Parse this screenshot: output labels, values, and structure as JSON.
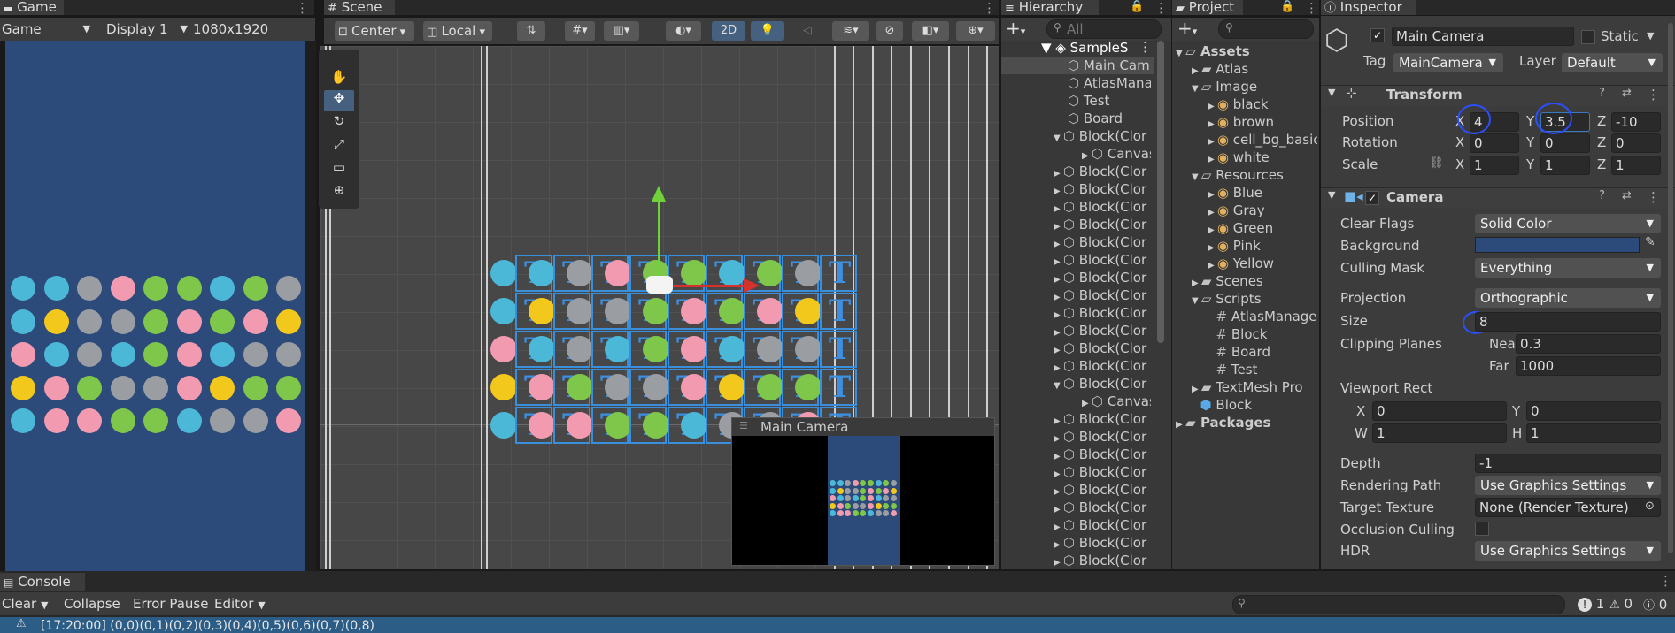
{
  "game": {
    "tab": "Game",
    "mode": "Game",
    "display": "Display 1",
    "resolution": "1080x1920",
    "bg": "#2c4a7a"
  },
  "scene": {
    "tab": "Scene",
    "pivot": "Center",
    "space": "Local",
    "toggle_2d": "2D",
    "preview_title": "Main Camera"
  },
  "hierarchy": {
    "tab": "Hierarchy",
    "search_placeholder": "All",
    "root": "SampleS",
    "items": [
      "Main Cam",
      "AtlasMana",
      "Test",
      "Board",
      "Block(Clor",
      "Canvas",
      "Block(Clor",
      "Block(Clor",
      "Block(Clor",
      "Block(Clor",
      "Block(Clor",
      "Block(Clor",
      "Block(Clor",
      "Block(Clor",
      "Block(Clor",
      "Block(Clor",
      "Block(Clor",
      "Block(Clor",
      "Block(Clor",
      "Canvas",
      "Block(Clor",
      "Block(Clor",
      "Block(Clor",
      "Block(Clor",
      "Block(Clor",
      "Block(Clor",
      "Block(Clor",
      "Block(Clor",
      "Block(Clor"
    ]
  },
  "project": {
    "tab": "Project",
    "tree": [
      {
        "label": "Assets",
        "indent": 0,
        "kind": "folder-open"
      },
      {
        "label": "Atlas",
        "indent": 1,
        "kind": "folder"
      },
      {
        "label": "Image",
        "indent": 1,
        "kind": "folder-open"
      },
      {
        "label": "black",
        "indent": 2,
        "kind": "sprite"
      },
      {
        "label": "brown",
        "indent": 2,
        "kind": "sprite"
      },
      {
        "label": "cell_bg_basic",
        "indent": 2,
        "kind": "sprite"
      },
      {
        "label": "white",
        "indent": 2,
        "kind": "sprite"
      },
      {
        "label": "Resources",
        "indent": 1,
        "kind": "folder-open"
      },
      {
        "label": "Blue",
        "indent": 2,
        "kind": "sprite"
      },
      {
        "label": "Gray",
        "indent": 2,
        "kind": "sprite"
      },
      {
        "label": "Green",
        "indent": 2,
        "kind": "sprite"
      },
      {
        "label": "Pink",
        "indent": 2,
        "kind": "sprite"
      },
      {
        "label": "Yellow",
        "indent": 2,
        "kind": "sprite"
      },
      {
        "label": "Scenes",
        "indent": 1,
        "kind": "folder"
      },
      {
        "label": "Scripts",
        "indent": 1,
        "kind": "folder-open"
      },
      {
        "label": "AtlasManage",
        "indent": 2,
        "kind": "script"
      },
      {
        "label": "Block",
        "indent": 2,
        "kind": "script"
      },
      {
        "label": "Board",
        "indent": 2,
        "kind": "script"
      },
      {
        "label": "Test",
        "indent": 2,
        "kind": "script"
      },
      {
        "label": "TextMesh Pro",
        "indent": 1,
        "kind": "folder"
      },
      {
        "label": "Block",
        "indent": 1,
        "kind": "prefab"
      },
      {
        "label": "Packages",
        "indent": 0,
        "kind": "folder"
      }
    ]
  },
  "inspector": {
    "tab": "Inspector",
    "object_name": "Main Camera",
    "static_label": "Static",
    "tag_label": "Tag",
    "tag_value": "MainCamera",
    "layer_label": "Layer",
    "layer_value": "Default",
    "transform": {
      "title": "Transform",
      "position_label": "Position",
      "rotation_label": "Rotation",
      "scale_label": "Scale",
      "position": {
        "x": "4",
        "y": "3.5",
        "z": "-10"
      },
      "rotation": {
        "x": "0",
        "y": "0",
        "z": "0"
      },
      "scale": {
        "x": "1",
        "y": "1",
        "z": "1"
      }
    },
    "camera": {
      "title": "Camera",
      "clear_flags_label": "Clear Flags",
      "clear_flags": "Solid Color",
      "background_label": "Background",
      "background_color": "#2c4a7a",
      "culling_mask_label": "Culling Mask",
      "culling_mask": "Everything",
      "projection_label": "Projection",
      "projection": "Orthographic",
      "size_label": "Size",
      "size": "8",
      "clipping_label": "Clipping Planes",
      "near_label": "Near",
      "near": "0.3",
      "far_label": "Far",
      "far": "1000",
      "viewport_label": "Viewport Rect",
      "vx": "0",
      "vy": "0",
      "vw": "1",
      "vh": "1",
      "depth_label": "Depth",
      "depth": "-1",
      "rendering_path_label": "Rendering Path",
      "rendering_path": "Use Graphics Settings",
      "target_texture_label": "Target Texture",
      "target_texture": "None (Render Texture)",
      "occlusion_label": "Occlusion Culling",
      "hdr_label": "HDR",
      "hdr": "Use Graphics Settings"
    }
  },
  "console": {
    "tab": "Console",
    "clear": "Clear",
    "collapse": "Collapse",
    "error_pause": "Error Pause",
    "editor": "Editor",
    "errors": "1",
    "warnings": "0",
    "logs": "0",
    "log_line": "[17:20:00] (0,0)(0,1)(0,2)(0,3)(0,4)(0,5)(0,6)(0,7)(0,8)"
  },
  "tiles": {
    "colors": {
      "blue": "#4cb8d8",
      "yellow": "#f3c81c",
      "gray": "#9a9ea3",
      "pink": "#f29bb0",
      "green": "#7ec74a"
    },
    "rows": [
      [
        "blue",
        "blue",
        "gray",
        "pink",
        "green",
        "green",
        "blue",
        "green",
        "gray"
      ],
      [
        "blue",
        "yellow",
        "gray",
        "gray",
        "green",
        "pink",
        "green",
        "pink",
        "yellow"
      ],
      [
        "pink",
        "blue",
        "gray",
        "blue",
        "green",
        "pink",
        "blue",
        "gray",
        "gray"
      ],
      [
        "yellow",
        "pink",
        "green",
        "gray",
        "gray",
        "pink",
        "yellow",
        "green",
        "green"
      ],
      [
        "blue",
        "pink",
        "pink",
        "green",
        "green",
        "blue",
        "gray",
        "gray",
        "pink"
      ]
    ]
  }
}
